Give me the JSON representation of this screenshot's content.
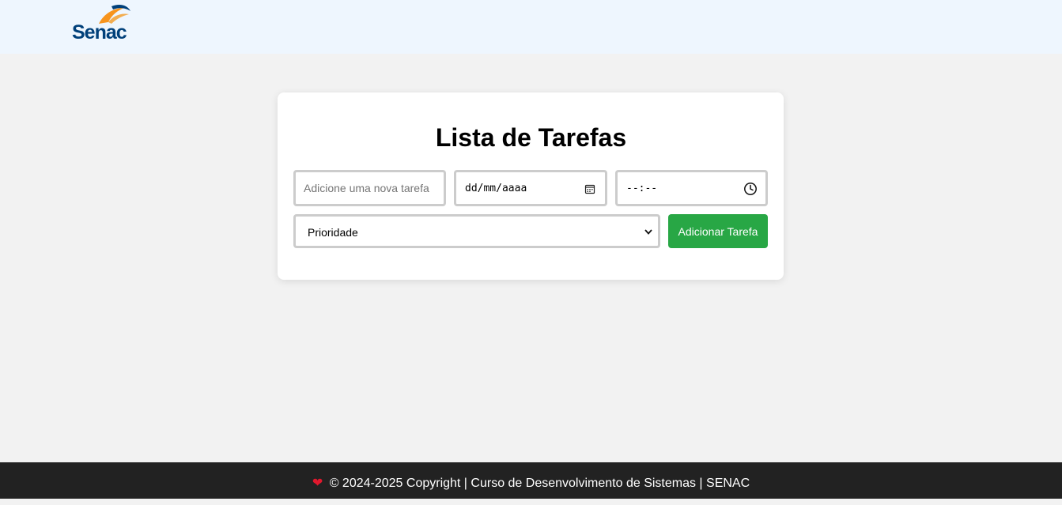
{
  "header": {
    "logo_text": "Senac",
    "logo_colors": {
      "text": "#00407a",
      "swoosh": "#f7941d"
    }
  },
  "main": {
    "title": "Lista de Tarefas",
    "task_input": {
      "placeholder": "Adicione uma nova tarefa",
      "value": ""
    },
    "date_input": {
      "display": "dd/mm/aaaa",
      "icon": "calendar-icon"
    },
    "time_input": {
      "display": "--:--",
      "icon": "clock-icon"
    },
    "priority_select": {
      "selected": "Prioridade"
    },
    "add_button_label": "Adicionar Tarefa",
    "accent_color": "#28a745"
  },
  "footer": {
    "heart_icon": "heart-icon",
    "heart_glyph": "❤",
    "text": "© 2024-2025 Copyright | Curso de Desenvolvimento de Sistemas | SENAC"
  }
}
